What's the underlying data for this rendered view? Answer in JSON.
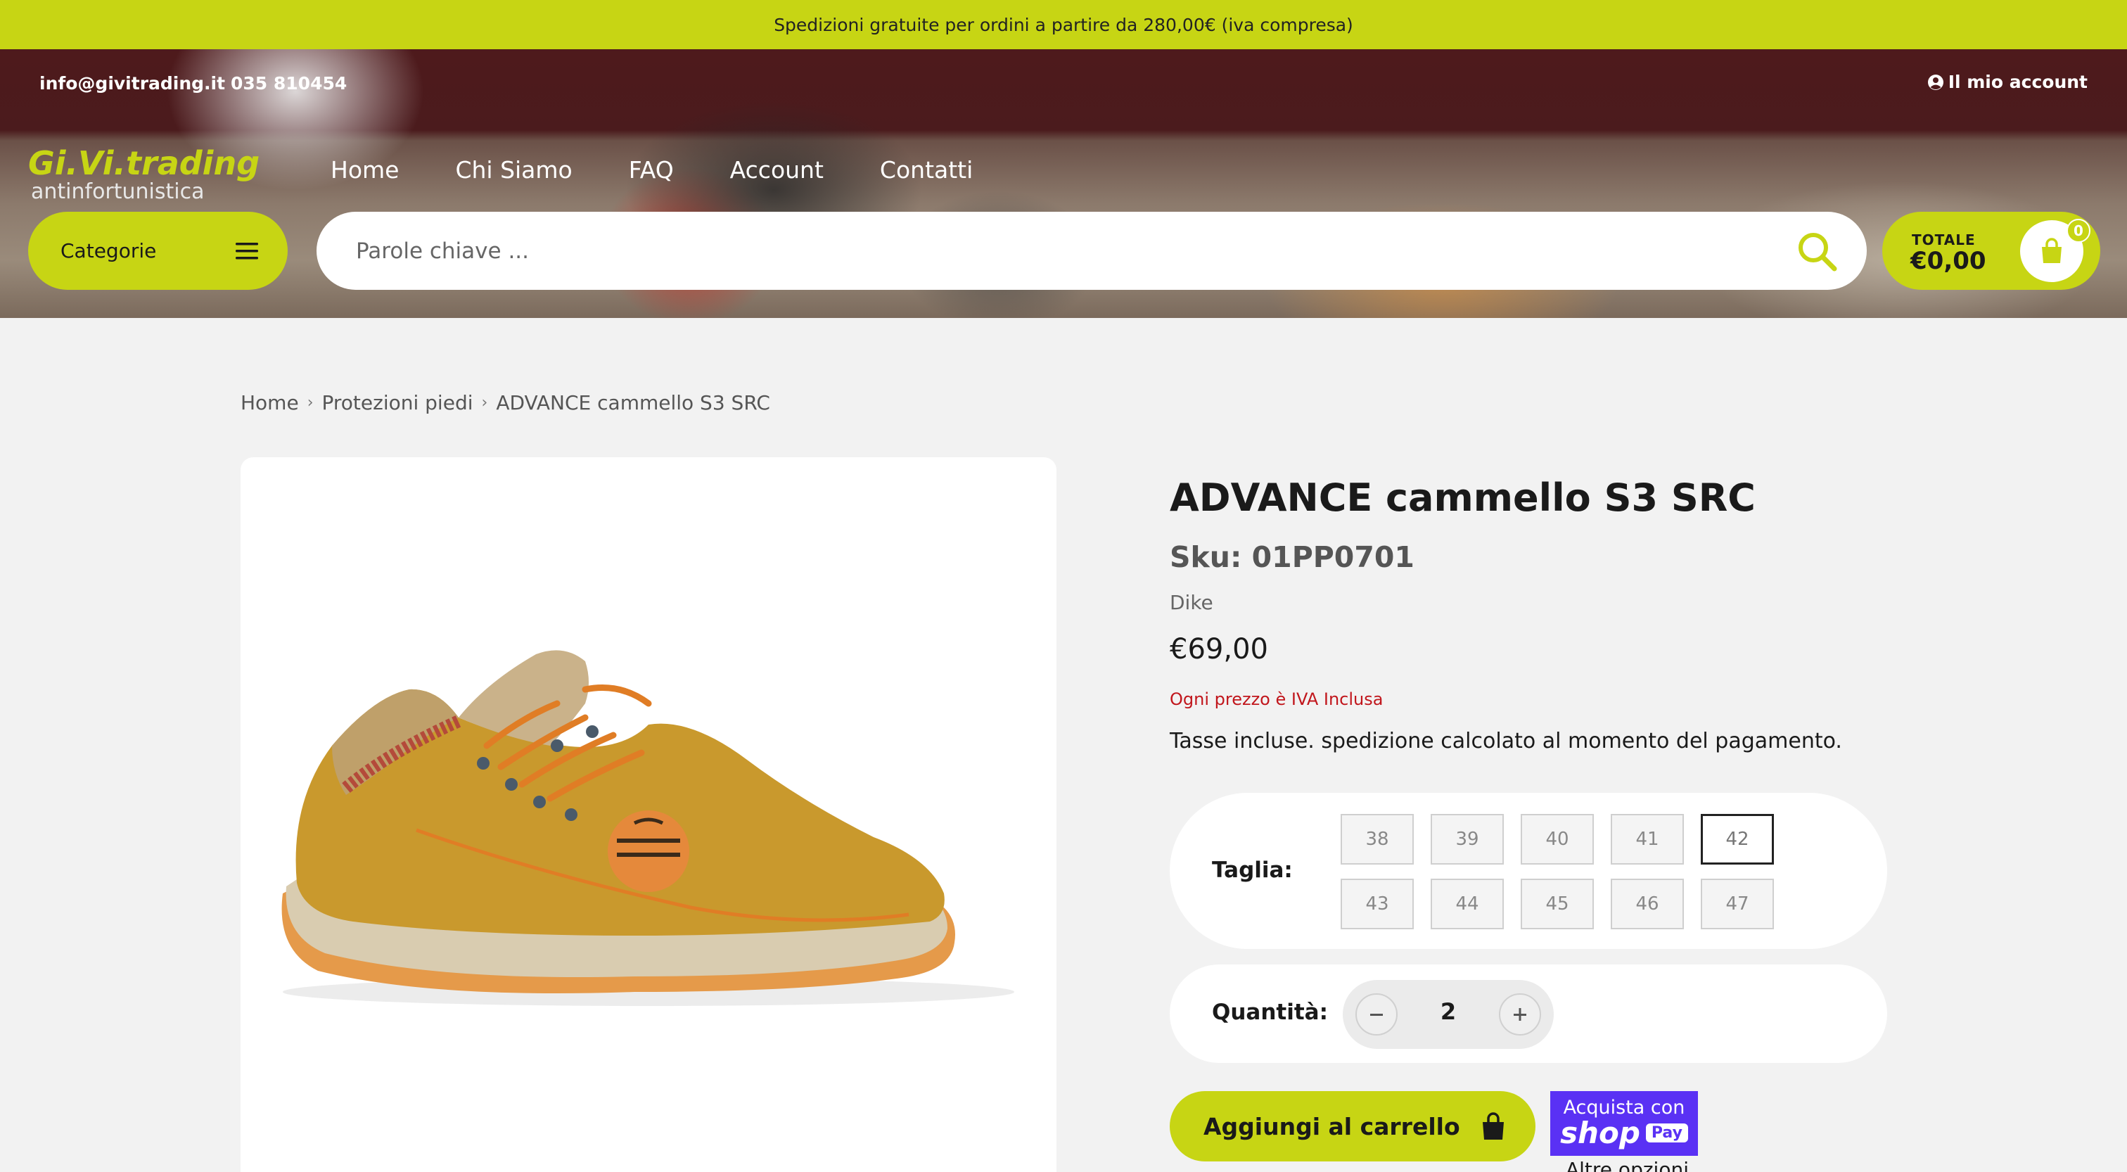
{
  "announcement": "Spedizioni gratuite per ordini a partire da 280,00€ (iva compresa)",
  "header": {
    "email": "info@givitrading.it",
    "phone": "035 810454",
    "account_label": "Il mio account",
    "logo_main": "Gi.Vi.trading",
    "logo_sub": "antinfortunistica",
    "nav": [
      "Home",
      "Chi Siamo",
      "FAQ",
      "Account",
      "Contatti"
    ],
    "categories_label": "Categorie",
    "search_placeholder": "Parole chiave ...",
    "cart": {
      "total_label": "TOTALE",
      "total_value": "€0,00",
      "count": "0"
    }
  },
  "breadcrumb": [
    "Home",
    "Protezioni piedi",
    "ADVANCE cammello S3 SRC"
  ],
  "product": {
    "title": "ADVANCE cammello S3 SRC",
    "sku": "Sku: 01PP0701",
    "brand": "Dike",
    "price": "€69,00",
    "vat_note": "Ogni prezzo è IVA Inclusa",
    "tax_note": "Tasse incluse. spedizione calcolato al momento del pagamento.",
    "size_label": "Taglia:",
    "sizes": [
      "38",
      "39",
      "40",
      "41",
      "42",
      "43",
      "44",
      "45",
      "46",
      "47"
    ],
    "selected_size": "42",
    "qty_label": "Quantità:",
    "qty_value": "2",
    "add_to_cart": "Aggiungi al carrello",
    "shop_pay_line1": "Acquista con",
    "shop_pay_brand": "shop",
    "shop_pay_badge": "Pay",
    "more_options": "Altre opzioni"
  },
  "colors": {
    "accent": "#c7d514",
    "vat_red": "#c1161c",
    "shop_pay": "#5a31f4"
  }
}
